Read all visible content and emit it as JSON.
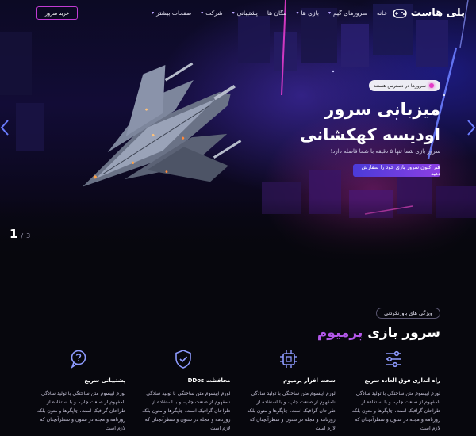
{
  "nav": {
    "logo_text": "پلی هاست",
    "menu": [
      {
        "label": "خانه",
        "has_chevron": false
      },
      {
        "label": "سرورهای گیم",
        "has_chevron": true
      },
      {
        "label": "بازی ها",
        "has_chevron": true
      },
      {
        "label": "مگان ها",
        "has_chevron": false
      },
      {
        "label": "پشتیبانی",
        "has_chevron": true
      },
      {
        "label": "شرکت",
        "has_chevron": true
      },
      {
        "label": "صفحات بیشتر",
        "has_chevron": true
      }
    ],
    "buy_button": "خرید سرور"
  },
  "hero": {
    "badge": "سرورها در دسترس هستند",
    "title": "میزبانی سرور اودیسه کهکشانی",
    "subtitle": "سرور بازی شما تنها ۵ دقیقه با شما فاصله دارد!",
    "cta": "هم اکنون سرور بازی خود را سفارش دهید",
    "slide_current": "1",
    "slide_separator": "/",
    "slide_total": "3"
  },
  "features": {
    "tag": "ویژگی های باورنکردنی",
    "title_part1": "سرور بازی",
    "title_part2": "پرمیوم",
    "accent_color": "#b257e8",
    "cards": [
      {
        "icon": "sliders-icon",
        "title": "راه اندازی فوق العاده سریع",
        "text": "لورم ایپسوم متن ساختگی با تولید سادگی نامفهوم از صنعت چاپ، و با استفاده از طراحان گرافیک است، چاپگرها و متون بلکه روزنامه و مجله در ستون و سطرآنچنان که لازم است"
      },
      {
        "icon": "cpu-icon",
        "title": "سخت افزار پرمیوم",
        "text": "لورم ایپسوم متن ساختگی با تولید سادگی نامفهوم از صنعت چاپ، و با استفاده از طراحان گرافیک است، چاپگرها و متون بلکه روزنامه و مجله در ستون و سطرآنچنان که لازم است"
      },
      {
        "icon": "shield-check-icon",
        "title": "محافظت DDos",
        "text": "لورم ایپسوم متن ساختگی با تولید سادگی نامفهوم از صنعت چاپ، و با استفاده از طراحان گرافیک است، چاپگرها و متون بلکه روزنامه و مجله در ستون و سطرآنچنان که لازم است"
      },
      {
        "icon": "support-chat-icon",
        "title": "پشتیبانی سریع",
        "text": "لورم ایپسوم متن ساختگی با تولید سادگی نامفهوم از صنعت چاپ، و با استفاده از طراحان گرافیک است، چاپگرها و متون بلکه روزنامه و مجله در ستون و سطرآنچنان که لازم است"
      }
    ]
  }
}
